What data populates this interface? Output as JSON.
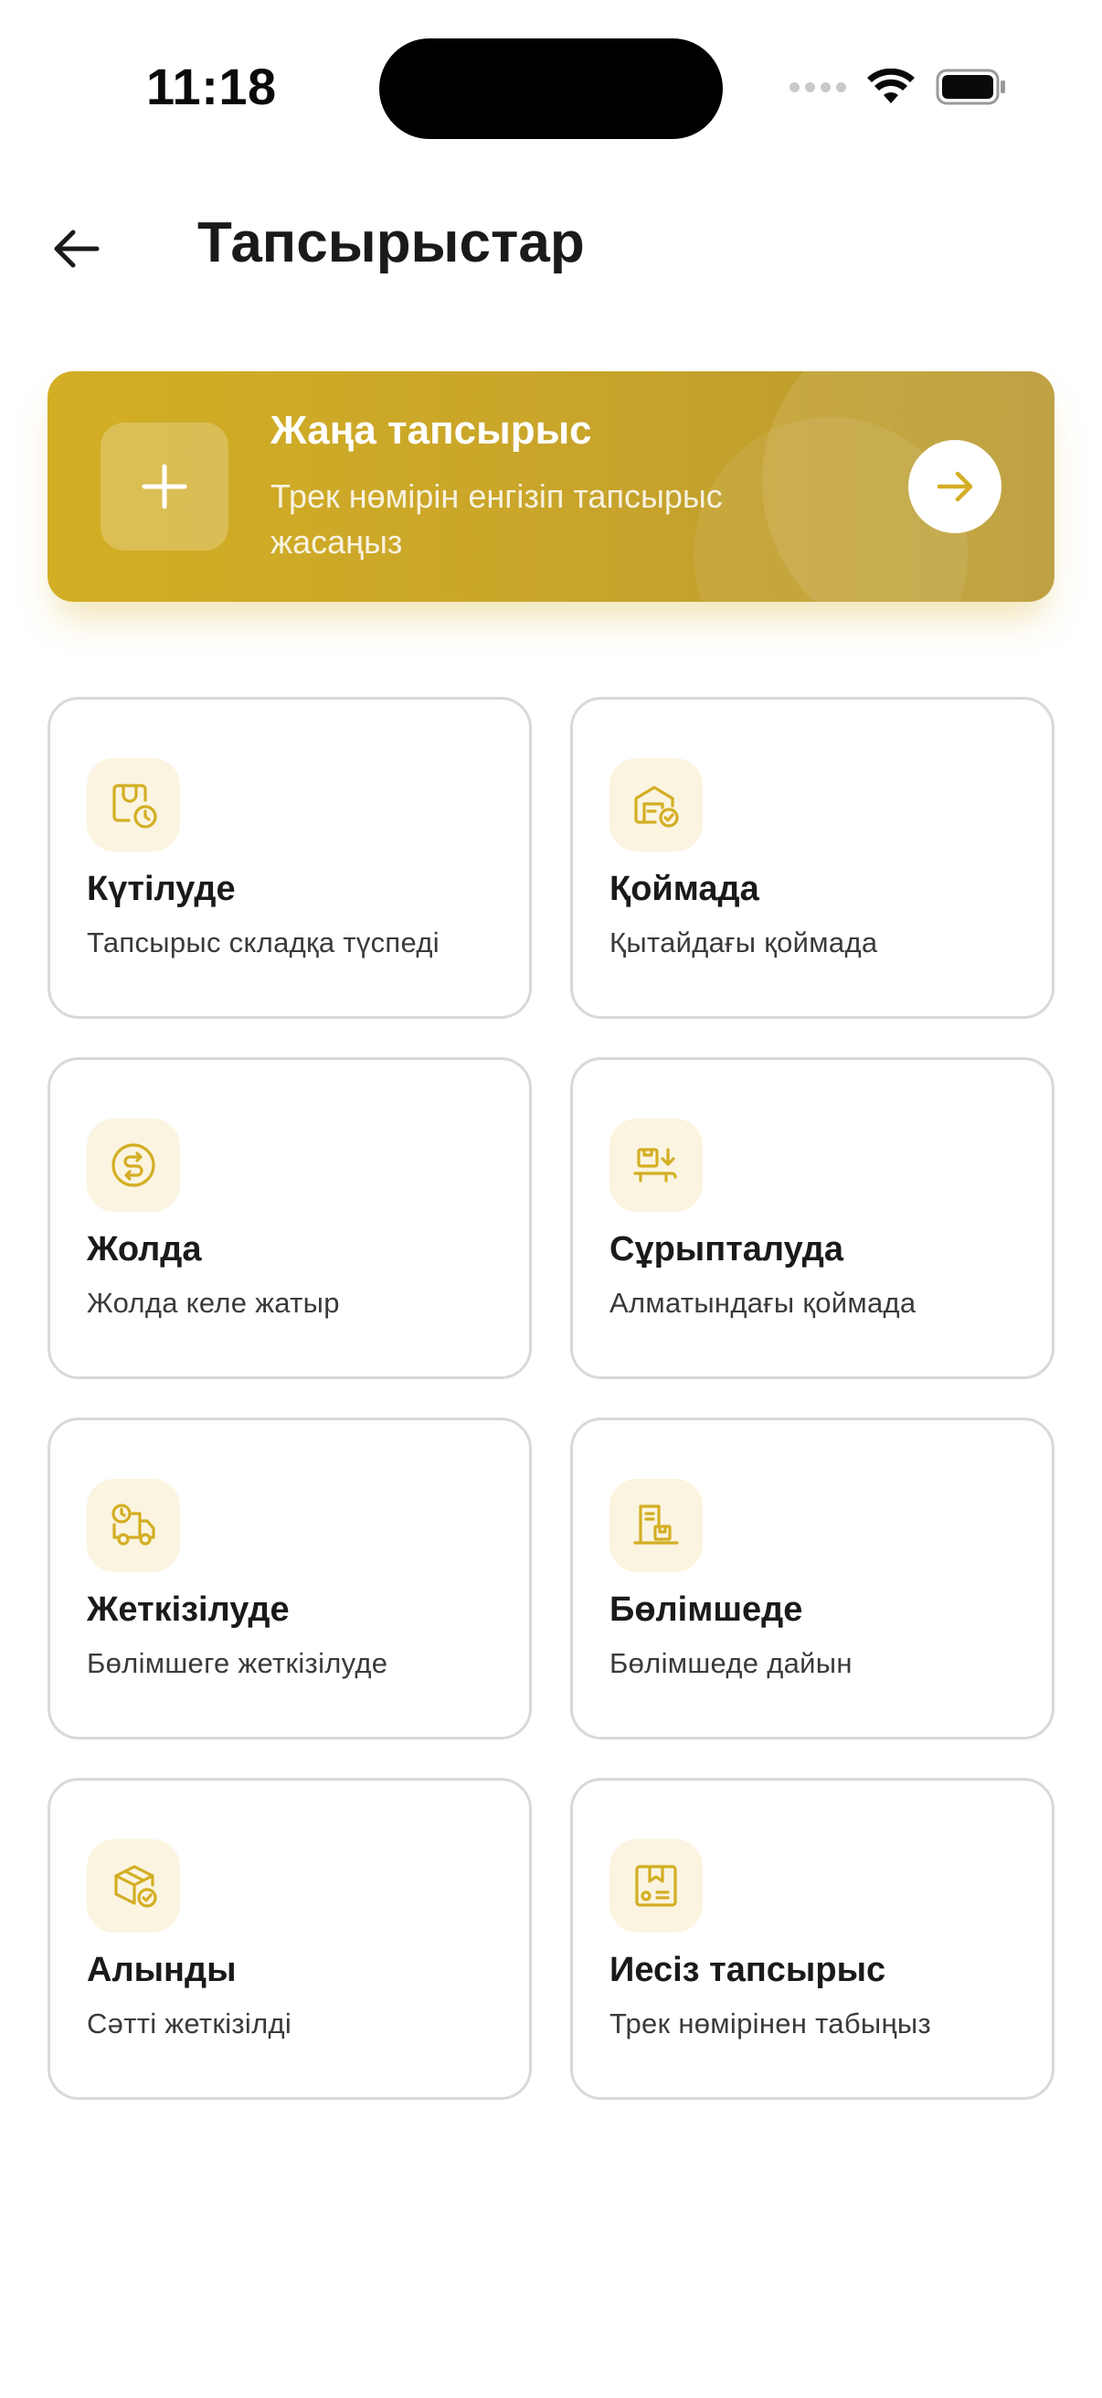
{
  "status_bar": {
    "time": "11:18"
  },
  "header": {
    "title": "Тапсырыстар"
  },
  "new_order": {
    "title": "Жаңа тапсырыс",
    "subtitle": "Трек нөмірін енгізіп тапсырыс жасаңыз"
  },
  "colors": {
    "accent": "#D3AE24",
    "icon_bg": "#FBF4E0",
    "card_border": "#D9D9D9"
  },
  "statuses": [
    {
      "title": "Күтілуде",
      "subtitle": "Тапсырыс складқа түспеді",
      "icon": "package-clock-icon"
    },
    {
      "title": "Қоймада",
      "subtitle": "Қытайдағы қоймада",
      "icon": "warehouse-check-icon"
    },
    {
      "title": "Жолда",
      "subtitle": "Жолда келе жатыр",
      "icon": "route-icon"
    },
    {
      "title": "Сұрыпталуда",
      "subtitle": "Алматындағы қоймада",
      "icon": "box-sorting-icon"
    },
    {
      "title": "Жеткізілуде",
      "subtitle": "Бөлімшеге жеткізілуде",
      "icon": "delivery-truck-icon"
    },
    {
      "title": "Бөлімшеде",
      "subtitle": "Бөлімшеде дайын",
      "icon": "branch-building-icon"
    },
    {
      "title": "Алынды",
      "subtitle": "Сәтті жеткізілді",
      "icon": "box-received-icon"
    },
    {
      "title": "Иесіз тапсырыс",
      "subtitle": "Трек нөмірінен табыңыз",
      "icon": "unclaimed-box-icon"
    }
  ]
}
